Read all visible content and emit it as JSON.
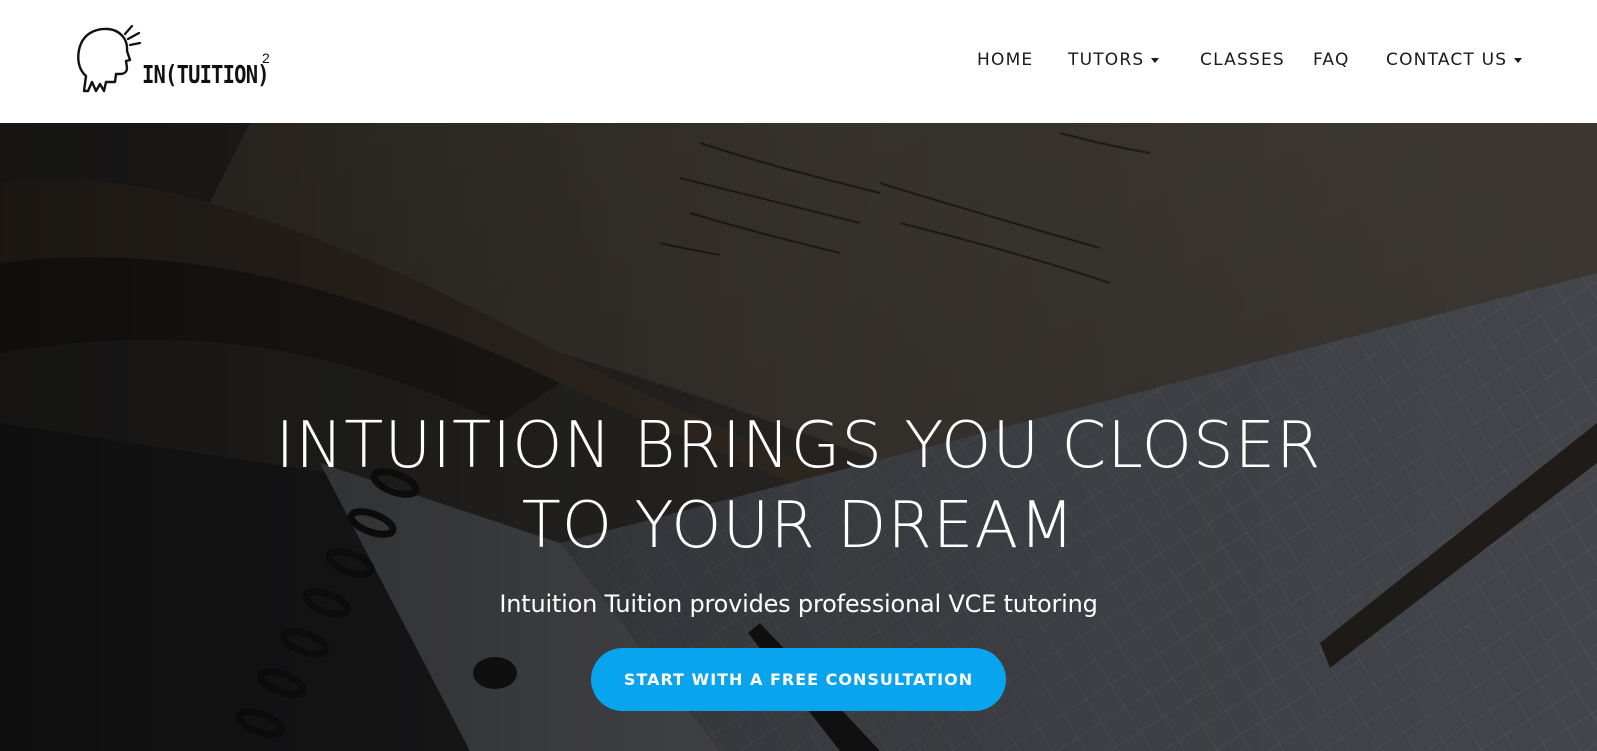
{
  "brand": {
    "logo_text": "IN(TUITION)",
    "logo_superscript": "2",
    "logo_icon": "head-speaking-icon"
  },
  "nav": {
    "items": [
      {
        "label": "HOME",
        "has_dropdown": false
      },
      {
        "label": "TUTORS",
        "has_dropdown": true
      },
      {
        "label": "CLASSES",
        "has_dropdown": false
      },
      {
        "label": "FAQ",
        "has_dropdown": false
      },
      {
        "label": "CONTACT US",
        "has_dropdown": true
      }
    ]
  },
  "hero": {
    "title_line1": "INTUITION BRINGS YOU CLOSER",
    "title_line2": "TO YOUR DREAM",
    "subtitle": "Intuition Tuition provides professional VCE tutoring",
    "cta_label": "START WITH A FREE CONSULTATION",
    "background": "dark-overlaid photo of an open math book with logarithm equations and a spiral notebook"
  },
  "colors": {
    "accent": "#08a4ee",
    "header_bg": "#ffffff",
    "nav_text": "#1a1a1a",
    "hero_text": "#ffffff"
  }
}
